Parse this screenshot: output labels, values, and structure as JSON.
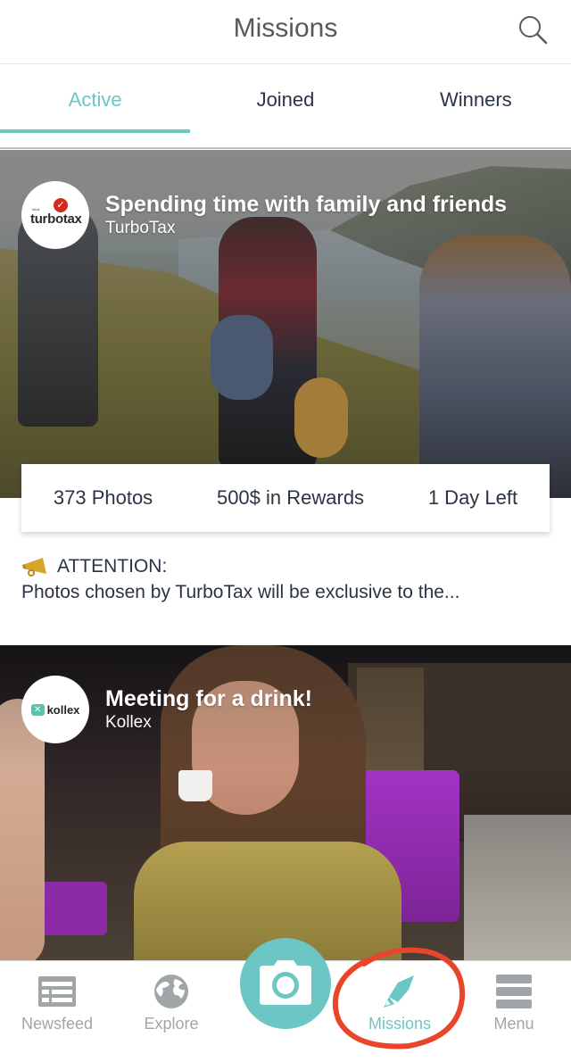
{
  "header": {
    "title": "Missions",
    "search_icon": "search-icon"
  },
  "tabs": [
    {
      "label": "Active",
      "active": true
    },
    {
      "label": "Joined",
      "active": false
    },
    {
      "label": "Winners",
      "active": false
    }
  ],
  "missions": [
    {
      "title": "Spending time with family and friends",
      "brand": "TurboTax",
      "logo": {
        "small_text": "intuit",
        "word": "turbotax",
        "check": "✓"
      },
      "stats": {
        "photos": "373 Photos",
        "rewards": "500$ in Rewards",
        "time_left": "1 Day Left"
      },
      "attention": {
        "icon": "megaphone-icon",
        "heading": "ATTENTION:",
        "text": "Photos chosen by TurboTax will be exclusive to the..."
      }
    },
    {
      "title": "Meeting for a drink!",
      "brand": "Kollex",
      "logo": {
        "mark": "✕",
        "word": "kollex"
      }
    }
  ],
  "bottom_nav": {
    "items": [
      {
        "label": "Newsfeed",
        "icon": "newsfeed-icon",
        "active": false
      },
      {
        "label": "Explore",
        "icon": "globe-icon",
        "active": false
      },
      {
        "label": "Missions",
        "icon": "rocket-icon",
        "active": true
      },
      {
        "label": "Menu",
        "icon": "menu-icon",
        "active": false
      }
    ],
    "camera": {
      "icon": "camera-icon"
    }
  },
  "colors": {
    "accent": "#6cc6c4",
    "text": "#2b3445",
    "inactive": "#a0a5a8",
    "annotation": "#e8452a"
  }
}
